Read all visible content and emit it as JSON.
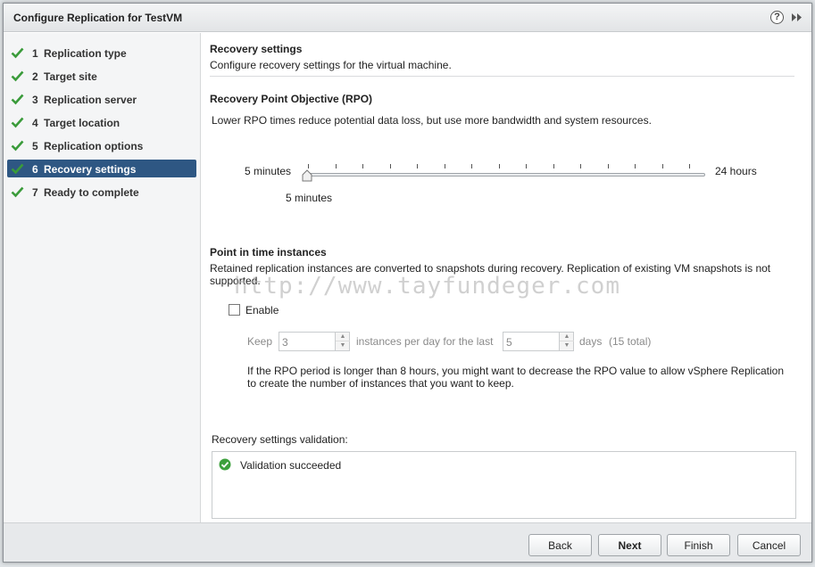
{
  "dialog": {
    "title": "Configure Replication for TestVM",
    "help_glyph": "?",
    "expand_glyph": "»"
  },
  "steps": [
    {
      "num": "1",
      "label": "Replication type",
      "done": true,
      "active": false
    },
    {
      "num": "2",
      "label": "Target site",
      "done": true,
      "active": false
    },
    {
      "num": "3",
      "label": "Replication server",
      "done": true,
      "active": false
    },
    {
      "num": "4",
      "label": "Target location",
      "done": true,
      "active": false
    },
    {
      "num": "5",
      "label": "Replication options",
      "done": true,
      "active": false
    },
    {
      "num": "6",
      "label": "Recovery settings",
      "done": true,
      "active": true
    },
    {
      "num": "7",
      "label": "Ready to complete",
      "done": true,
      "active": false
    }
  ],
  "page": {
    "title": "Recovery settings",
    "subtitle": "Configure recovery settings for the virtual machine."
  },
  "rpo": {
    "heading": "Recovery Point Objective (RPO)",
    "description": "Lower RPO times reduce potential data loss, but use more bandwidth and system resources.",
    "min_label": "5 minutes",
    "max_label": "24 hours",
    "current_label": "5 minutes",
    "value_fraction": 0.0
  },
  "pit": {
    "heading": "Point in time instances",
    "description_line1": "Retained replication instances are converted to snapshots during recovery. Replication of existing VM snapshots is not",
    "description_line2": "supported.",
    "enable_label": "Enable",
    "enabled": false,
    "keep_label": "Keep",
    "instances_value": "3",
    "instances_label": "instances per day for the last",
    "days_value": "5",
    "days_label": "days",
    "total_label": "(15 total)",
    "note_line1": "If the RPO period is longer than 8 hours, you might want to decrease the RPO value to allow vSphere Replication",
    "note_line2": "to create the number of instances that you want to keep."
  },
  "watermark": "http://www.tayfundeger.com",
  "validation": {
    "heading": "Recovery settings validation:",
    "message": "Validation succeeded"
  },
  "buttons": {
    "back": "Back",
    "next": "Next",
    "finish": "Finish",
    "cancel": "Cancel"
  },
  "colors": {
    "active_step": "#2e5783",
    "check_green": "#3a9b3a",
    "ok_green": "#3ca03c"
  }
}
